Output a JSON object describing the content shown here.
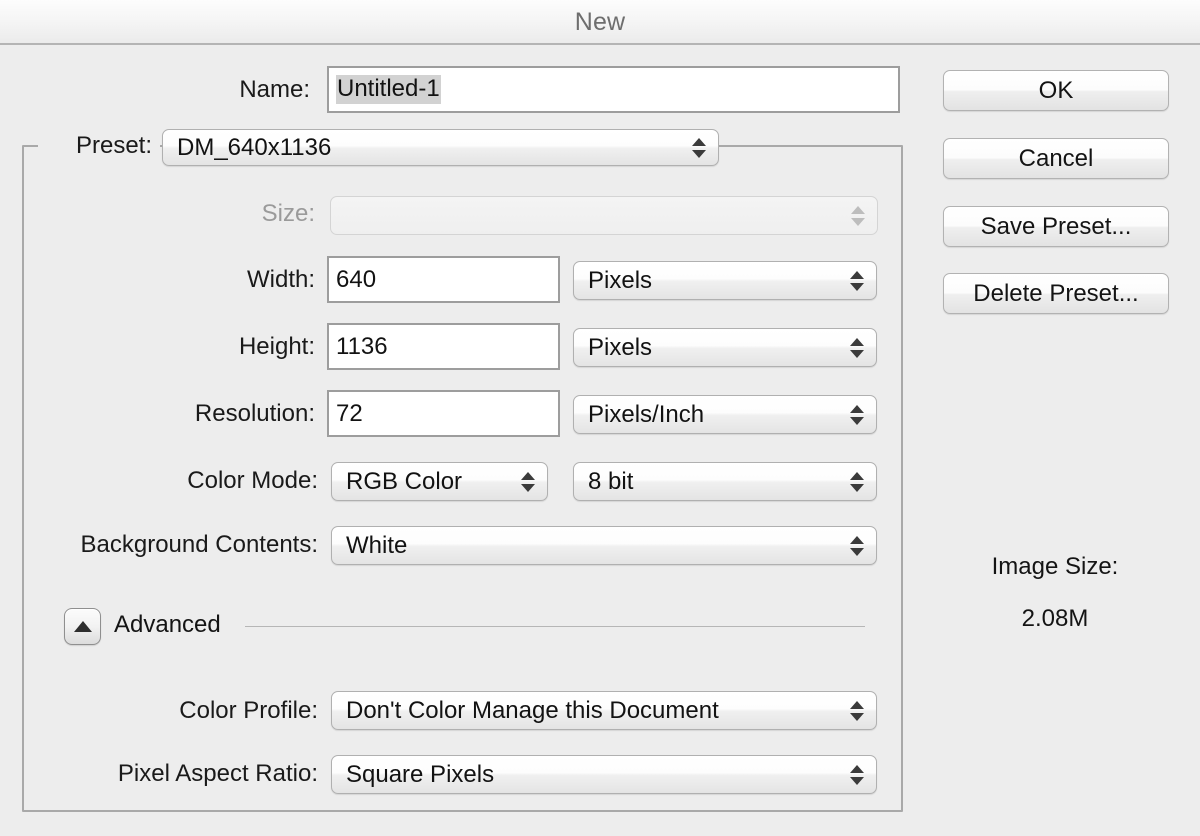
{
  "window": {
    "title": "New"
  },
  "name_row": {
    "label": "Name:",
    "value": "Untitled-1",
    "placeholder": "Untitled-1"
  },
  "preset_row": {
    "label": "Preset:",
    "value": "DM_640x1136"
  },
  "size_row": {
    "label": "Size:",
    "value": "",
    "disabled": true
  },
  "width_row": {
    "label": "Width:",
    "value": "640",
    "unit": "Pixels"
  },
  "height_row": {
    "label": "Height:",
    "value": "1136",
    "unit": "Pixels"
  },
  "resolution_row": {
    "label": "Resolution:",
    "value": "72",
    "unit": "Pixels/Inch"
  },
  "color_mode_row": {
    "label": "Color Mode:",
    "mode": "RGB Color",
    "depth": "8 bit"
  },
  "background_row": {
    "label": "Background Contents:",
    "value": "White"
  },
  "advanced": {
    "title": "Advanced",
    "expanded": true,
    "color_profile": {
      "label": "Color Profile:",
      "value": "Don't Color Manage this Document"
    },
    "pixel_aspect_ratio": {
      "label": "Pixel Aspect Ratio:",
      "value": "Square Pixels"
    }
  },
  "buttons": {
    "ok": "OK",
    "cancel": "Cancel",
    "save_preset": "Save Preset...",
    "delete_preset": "Delete Preset..."
  },
  "image_size": {
    "label": "Image Size:",
    "value": "2.08M"
  },
  "colors": {
    "background": "#ededed",
    "titlebar_text": "#6e6e6e",
    "text": "#141414",
    "disabled_text": "#9a9a9a",
    "selection_highlight": "#d2d2d2",
    "border": "#a9a9a9"
  }
}
